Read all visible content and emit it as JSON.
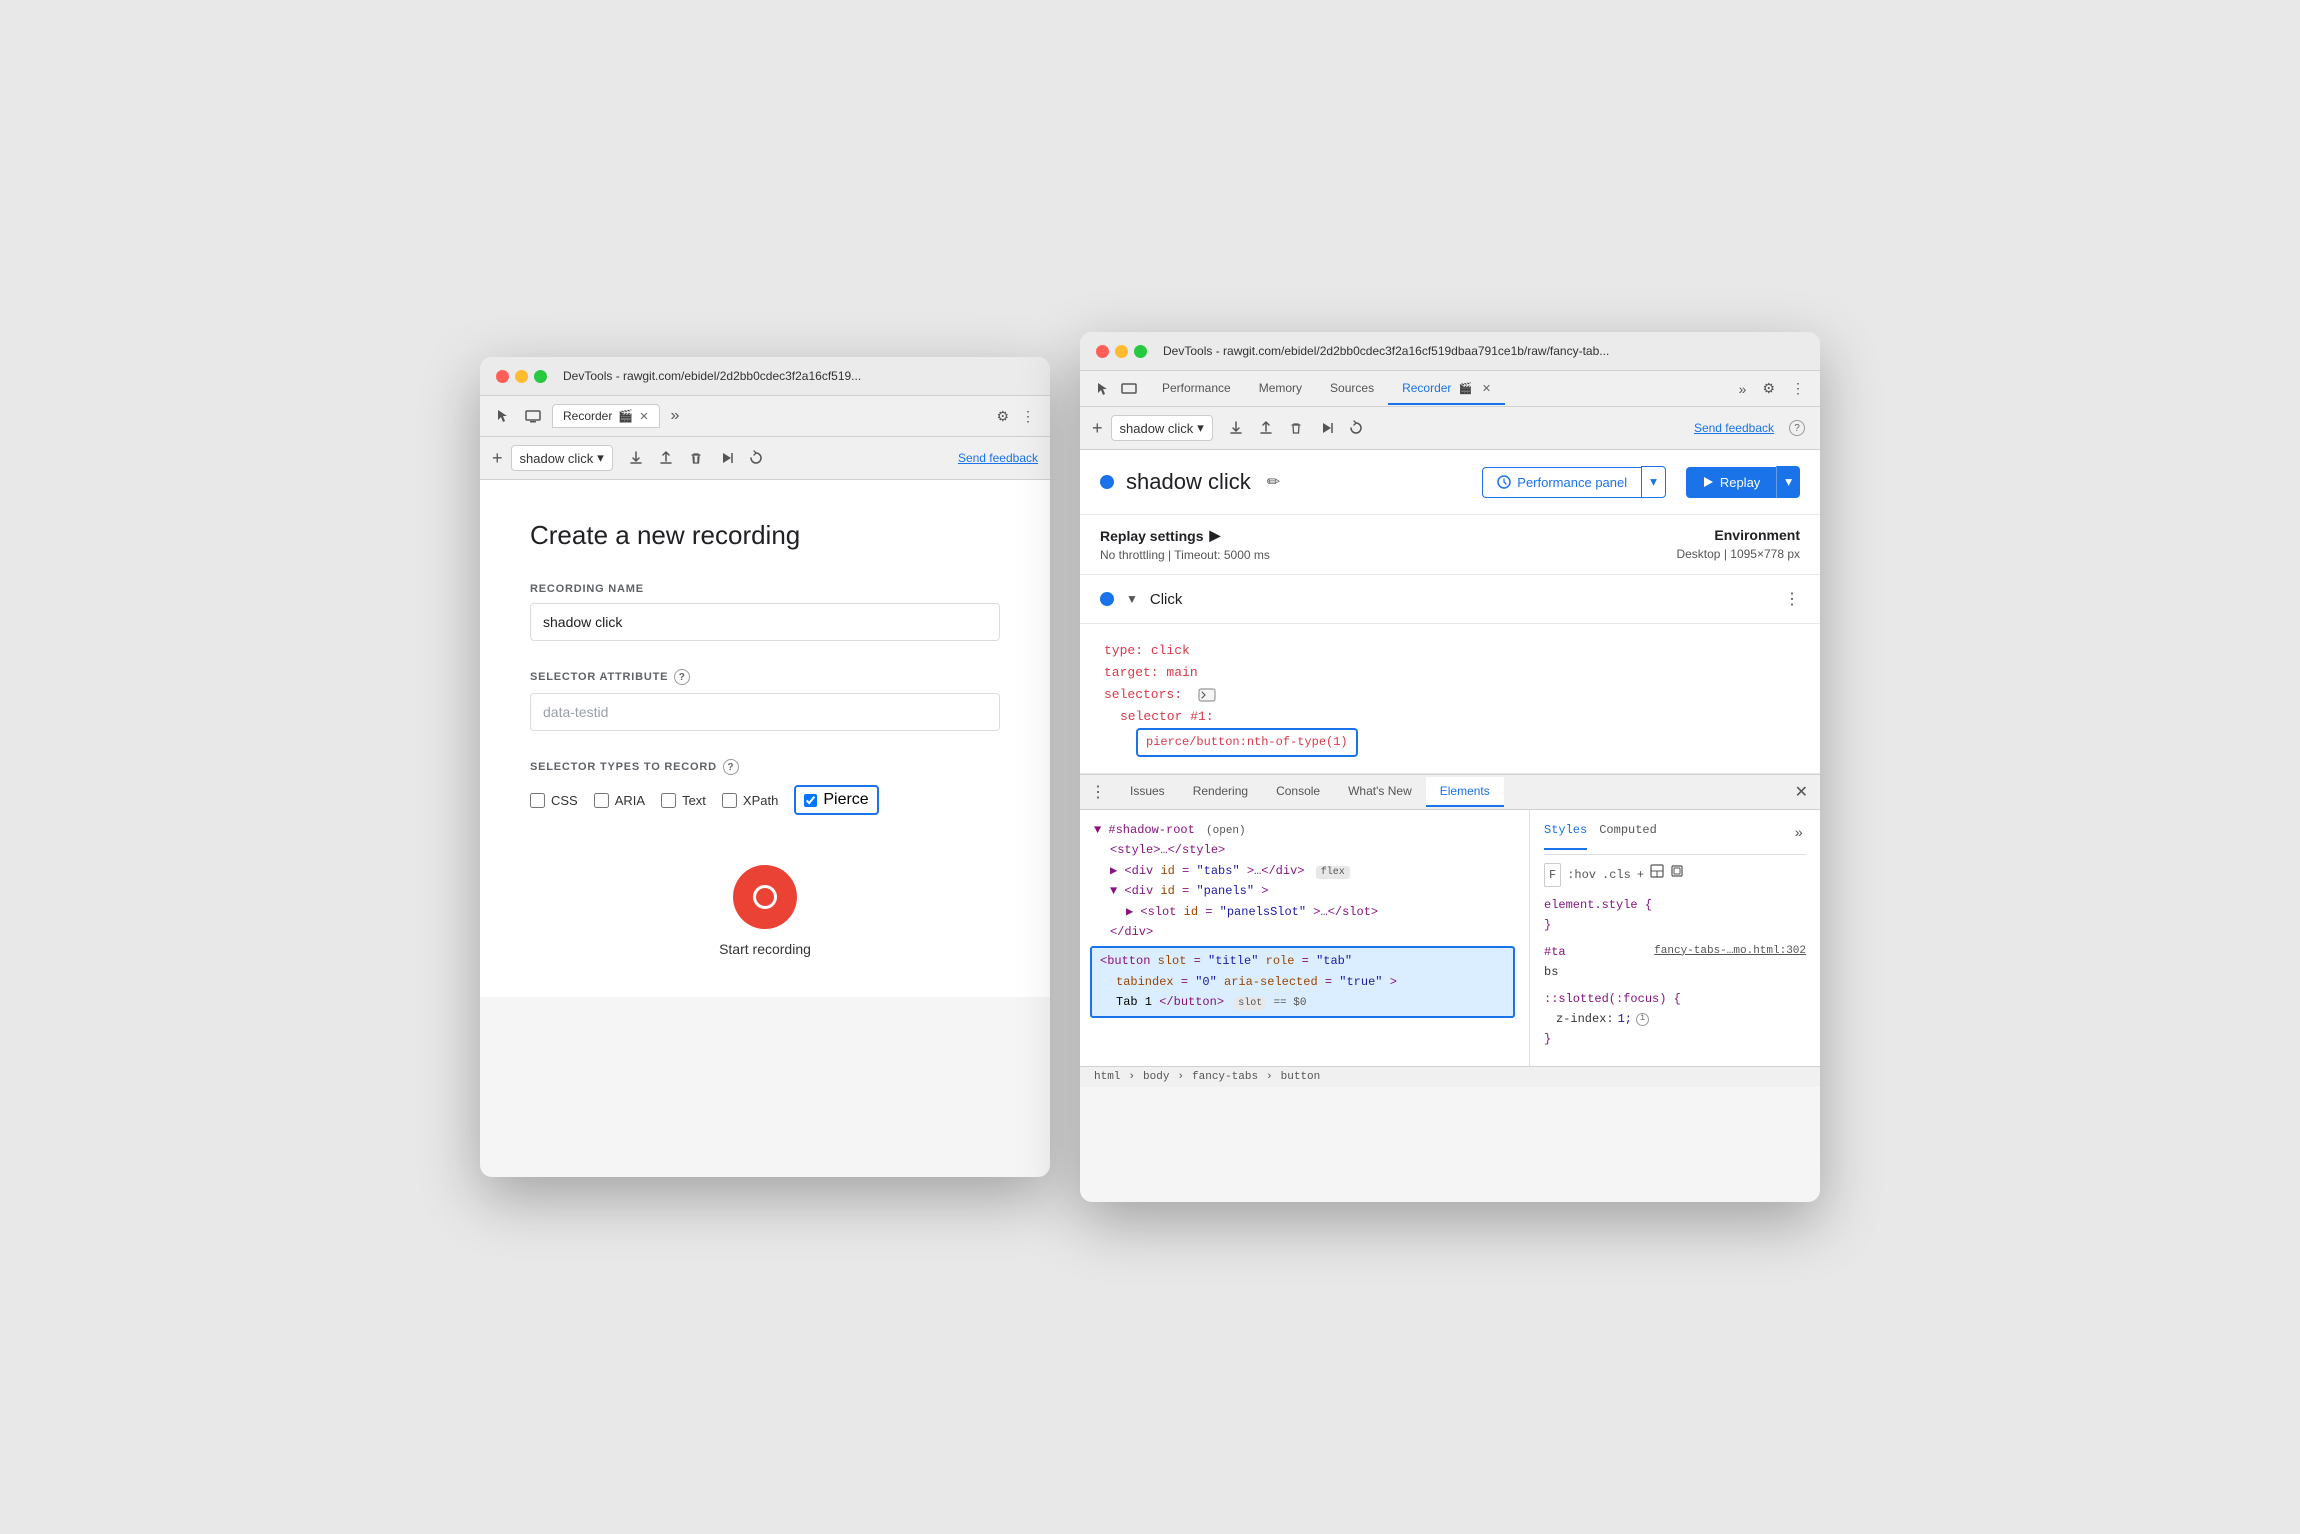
{
  "left_window": {
    "title": "DevTools - rawgit.com/ebidel/2d2bb0cdec3f2a16cf519...",
    "tab_label": "Recorder",
    "tab_icon": "🎬",
    "create_title": "Create a new recording",
    "recording_name_label": "RECORDING NAME",
    "recording_name_value": "shadow click",
    "selector_attr_label": "SELECTOR ATTRIBUTE",
    "selector_attr_placeholder": "data-testid",
    "selector_types_label": "SELECTOR TYPES TO RECORD",
    "checkboxes": [
      {
        "label": "CSS",
        "checked": false
      },
      {
        "label": "ARIA",
        "checked": false
      },
      {
        "label": "Text",
        "checked": false
      },
      {
        "label": "XPath",
        "checked": false
      },
      {
        "label": "Pierce",
        "checked": true
      }
    ],
    "start_label": "Start recording",
    "send_feedback": "Send feedback"
  },
  "right_window": {
    "title": "DevTools - rawgit.com/ebidel/2d2bb0cdec3f2a16cf519dbaa791ce1b/raw/fancy-tab...",
    "tabs": [
      "Performance",
      "Memory",
      "Sources",
      "Recorder"
    ],
    "active_tab": "Recorder",
    "toolbar": {
      "recording_name": "shadow click",
      "send_feedback": "Send feedback"
    },
    "recorder": {
      "recording_name": "shadow click",
      "perf_panel_label": "Performance panel",
      "replay_label": "Replay"
    },
    "replay_settings": {
      "title": "Replay settings",
      "throttling": "No throttling",
      "timeout": "Timeout: 5000 ms",
      "env_title": "Environment",
      "env_value": "Desktop",
      "env_size": "1095×778 px"
    },
    "click_step": {
      "label": "Click"
    },
    "code": {
      "type_key": "type:",
      "type_val": "click",
      "target_key": "target:",
      "target_val": "main",
      "selectors_key": "selectors:",
      "selector_num_label": "selector #1:",
      "selector_value": "pierce/button:nth-of-type(1)"
    },
    "devtools_bottom_tabs": [
      "Issues",
      "Rendering",
      "Console",
      "What's New",
      "Elements"
    ],
    "active_bottom_tab": "Elements",
    "html_tree": {
      "line1": "▼ #shadow-root",
      "line1_badge": "(open)",
      "line2": "<style>…</style>",
      "line3": "▶ <div id=\"tabs\">…</div>",
      "line3_badge": "flex",
      "line4": "▼ <div id=\"panels\">",
      "line5": "▶ <slot id=\"panelsSlot\">…</slot>",
      "line6": "</div>",
      "selected_line": "<button slot=\"title\" role=\"tab\" tabindex=\"0\" aria-selected=\"true\"> Tab 1</button>",
      "selected_line2": "tabindex=\"0\" aria-selected=\"true\">",
      "selected_line3": "Tab 1</button>",
      "slot_badge": "slot",
      "equals_badge": "== $0"
    },
    "styles_panel": {
      "tabs": [
        "Styles",
        "Computed"
      ],
      "toolbar": [
        "F",
        ":hov",
        ".cls",
        "+"
      ],
      "rule1_selector": "element.style {",
      "rule1_close": "}",
      "rule2_selector": "#ta",
      "rule2_file": "fancy-tabs-…mo.html:302",
      "rule2_sub": "bs",
      "rule3_selector": "::slotted(:focus) {",
      "rule3_prop": "z-index:",
      "rule3_val": "1;",
      "rule3_close": "}"
    },
    "breadcrumb": [
      "html",
      "body",
      "fancy-tabs",
      "button"
    ]
  }
}
